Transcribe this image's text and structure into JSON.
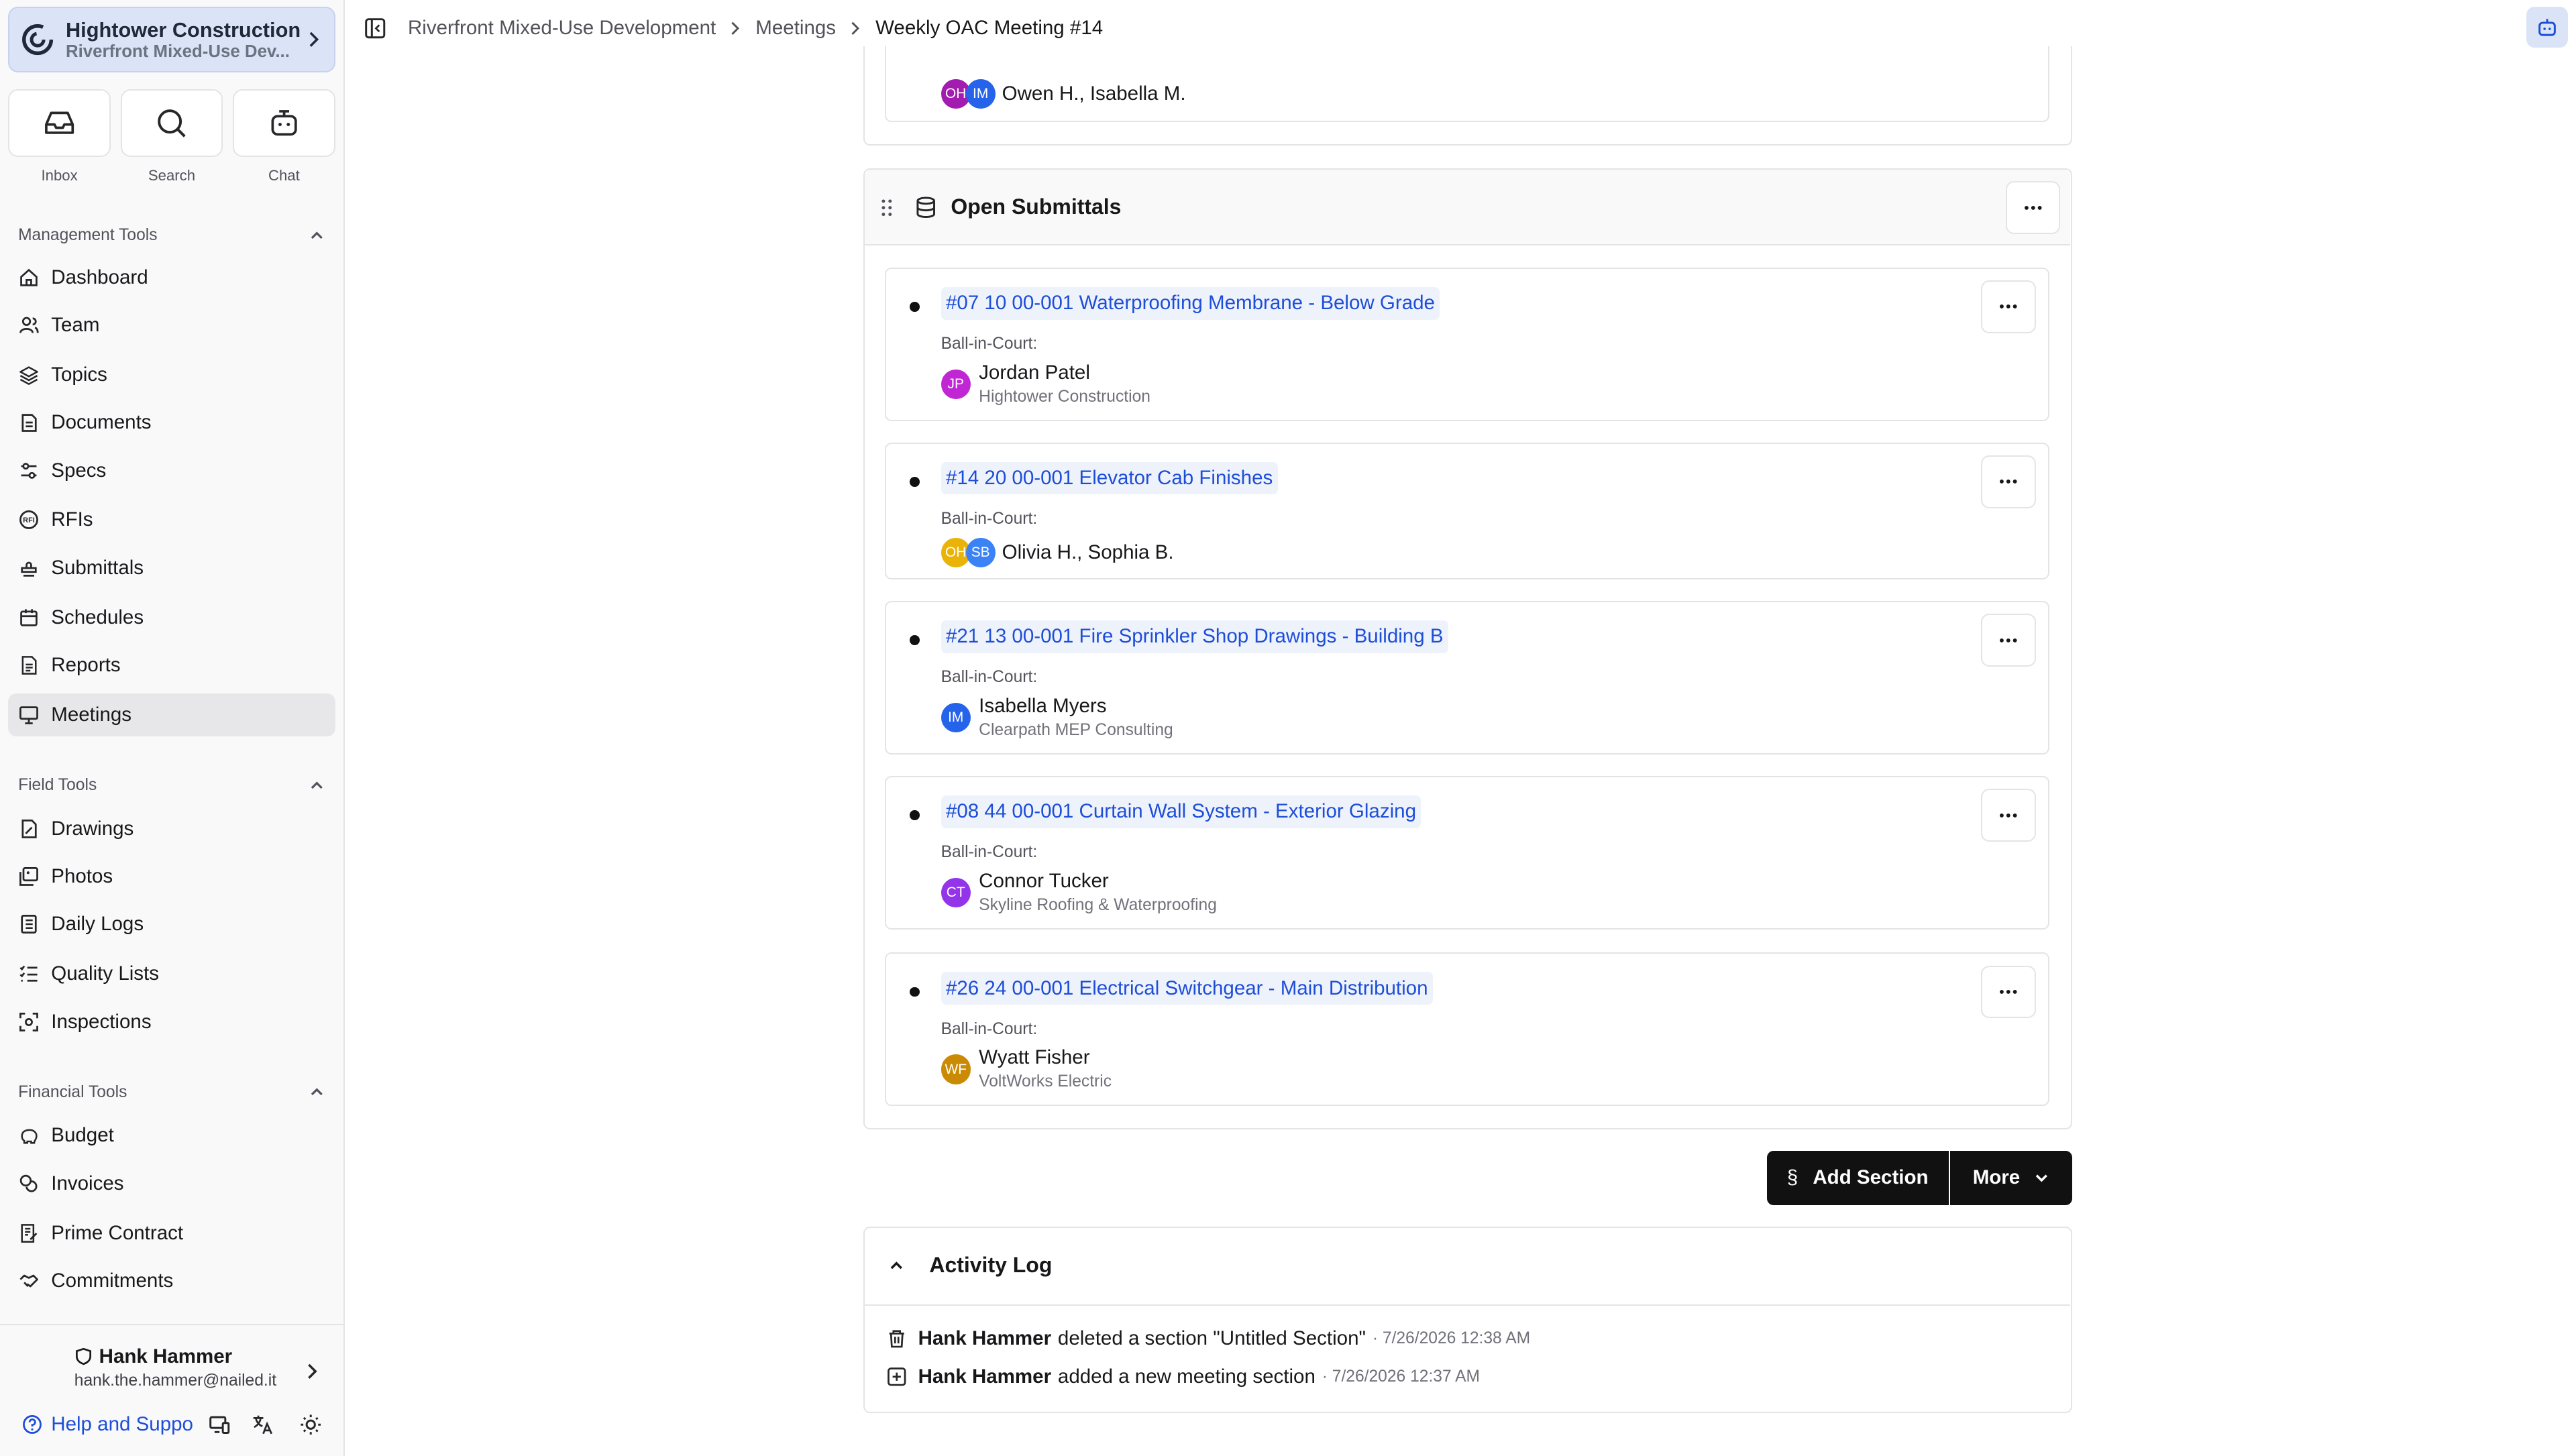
{
  "org": {
    "name": "Hightower Construction",
    "project": "Riverfront Mixed-Use Dev..."
  },
  "quick_actions": [
    {
      "label": "Inbox",
      "icon": "inbox-icon"
    },
    {
      "label": "Search",
      "icon": "search-icon"
    },
    {
      "label": "Chat",
      "icon": "bot-icon"
    }
  ],
  "groups": {
    "management": "Management Tools",
    "field": "Field Tools",
    "financial": "Financial Tools"
  },
  "nav": {
    "dashboard": "Dashboard",
    "team": "Team",
    "topics": "Topics",
    "documents": "Documents",
    "specs": "Specs",
    "rfis": "RFIs",
    "submittals": "Submittals",
    "schedules": "Schedules",
    "reports": "Reports",
    "meetings": "Meetings",
    "drawings": "Drawings",
    "photos": "Photos",
    "daily_logs": "Daily Logs",
    "quality_lists": "Quality Lists",
    "inspections": "Inspections",
    "budget": "Budget",
    "invoices": "Invoices",
    "prime_contract": "Prime Contract",
    "commitments": "Commitments"
  },
  "user": {
    "name": "Hank Hammer",
    "email": "hank.the.hammer@nailed.it"
  },
  "help_label": "Help and Suppo",
  "breadcrumb": [
    "Riverfront Mixed-Use Development",
    "Meetings",
    "Weekly OAC Meeting #14"
  ],
  "prev_item": {
    "people": "Owen H., Isabella M.",
    "avatars": [
      {
        "initials": "OH",
        "color": "#a21caf"
      },
      {
        "initials": "IM",
        "color": "#2563eb"
      }
    ]
  },
  "section": {
    "title": "Open Submittals",
    "ball_label": "Ball-in-Court:",
    "items": [
      {
        "title": "#07 10 00-001 Waterproofing Membrane - Below Grade",
        "initials": "JP",
        "color": "#c026d3",
        "name": "Jordan Patel",
        "company": "Hightower Construction"
      },
      {
        "title": "#14 20 00-001 Elevator Cab Finishes",
        "names": "Olivia H., Sophia B.",
        "avatars": [
          {
            "initials": "OH",
            "color": "#eab308"
          },
          {
            "initials": "SB",
            "color": "#3b82f6"
          }
        ]
      },
      {
        "title": "#21 13 00-001 Fire Sprinkler Shop Drawings - Building B",
        "initials": "IM",
        "color": "#2563eb",
        "name": "Isabella Myers",
        "company": "Clearpath MEP Consulting"
      },
      {
        "title": "#08 44 00-001 Curtain Wall System - Exterior Glazing",
        "initials": "CT",
        "color": "#9333ea",
        "name": "Connor Tucker",
        "company": "Skyline Roofing & Waterproofing"
      },
      {
        "title": "#26 24 00-001 Electrical Switchgear - Main Distribution",
        "initials": "WF",
        "color": "#ca8a04",
        "name": "Wyatt Fisher",
        "company": "VoltWorks Electric"
      }
    ]
  },
  "actions": {
    "add_section": "Add Section",
    "more": "More"
  },
  "activity": {
    "title": "Activity Log",
    "entries": [
      {
        "user": "Hank Hammer",
        "text": "deleted a section \"Untitled Section\"",
        "time": "· 7/26/2026 12:38 AM",
        "icon": "trash-icon"
      },
      {
        "user": "Hank Hammer",
        "text": "added a new meeting section",
        "time": "· 7/26/2026 12:37 AM",
        "icon": "plus-square-icon"
      }
    ]
  }
}
